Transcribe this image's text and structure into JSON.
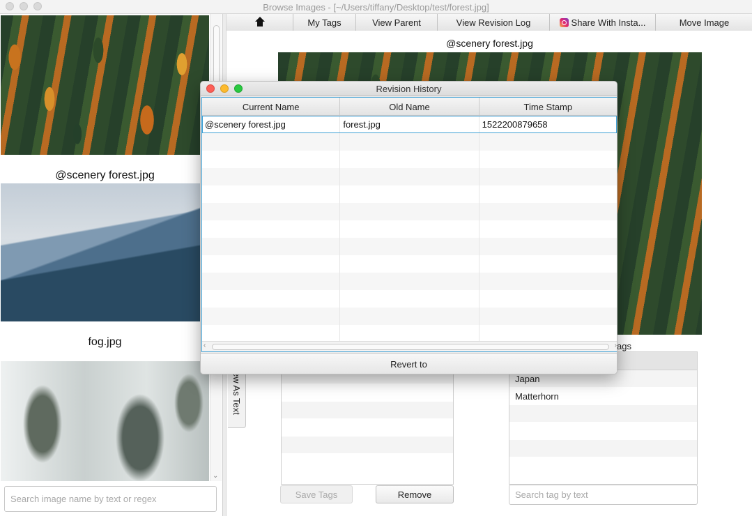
{
  "window": {
    "title": "Browse Images - [~/Users/tiffany/Desktop/test/forest.jpg]"
  },
  "left_panel": {
    "images": [
      {
        "caption": "",
        "kind": "forest"
      },
      {
        "caption": "@scenery forest.jpg",
        "kind": "fog"
      },
      {
        "caption": "fog.jpg",
        "kind": "snow"
      }
    ],
    "search_placeholder": "Search image name by text or regex"
  },
  "toolbar": {
    "home_icon": "home-icon",
    "my_tags": "My Tags",
    "view_parent": "View Parent",
    "view_revision_log": "View Revision Log",
    "share": "Share With Insta...",
    "share_icon": "instagram-icon",
    "move_image": "Move Image"
  },
  "main": {
    "image_caption": "@scenery forest.jpg",
    "tags_caption": "ags",
    "side_tab_label": "ew As Text",
    "available_tags": [
      "Japan",
      "Matterhorn"
    ],
    "save_tags": "Save Tags",
    "remove": "Remove",
    "search_tag_placeholder": "Search tag by text"
  },
  "dialog": {
    "title": "Revision History",
    "columns": [
      "Current Name",
      "Old Name",
      "Time Stamp"
    ],
    "rows": [
      [
        "@scenery forest.jpg",
        "forest.jpg",
        "1522200879658"
      ]
    ],
    "revert_label": "Revert to"
  },
  "colors": {
    "selection_border": "#3fa0d4",
    "close": "#fc5f57",
    "minimize": "#fdbb2e",
    "zoom": "#29c940"
  }
}
